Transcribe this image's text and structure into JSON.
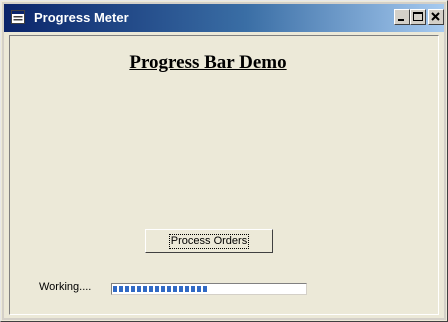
{
  "window": {
    "title": "Progress Meter",
    "title_color": "#ffffff",
    "titlebar_color": "#0a246a"
  },
  "titlebar_buttons": {
    "minimize_icon": "minimize-icon",
    "maximize_icon": "maximize-icon",
    "close_icon": "close-icon"
  },
  "form": {
    "heading": "Progress Bar Demo",
    "process_button_label": "Process Orders",
    "status_label": "Working....",
    "progress_fraction": 0.5,
    "progress_color": "#316ac5"
  }
}
